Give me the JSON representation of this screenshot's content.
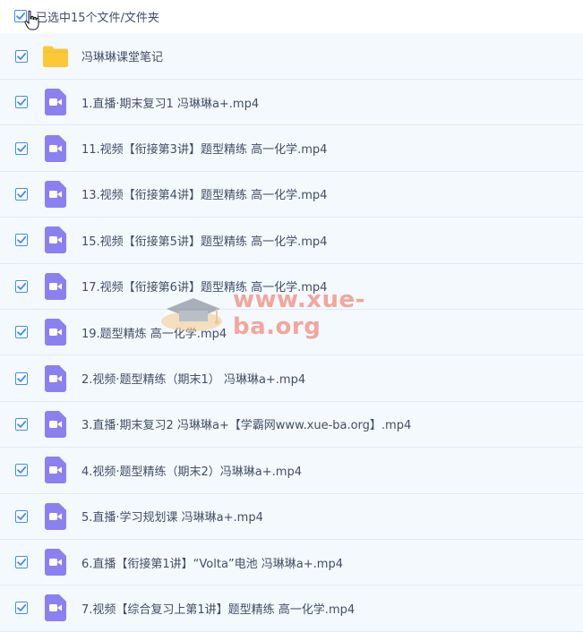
{
  "header": {
    "selection_label": "已选中15个文件/文件夹"
  },
  "colors": {
    "accent": "#3b8cff",
    "video_icon": "#8b80f0",
    "folder_icon": "#fcc838",
    "row_bg": "#f4f9fe"
  },
  "files": [
    {
      "name": "冯琳琳课堂笔记",
      "icon": "folder-icon"
    },
    {
      "name": "1.直播·期末复习1 冯琳琳a+.mp4",
      "icon": "video-file-icon"
    },
    {
      "name": "11.视频【衔接第3讲】题型精练 高一化学.mp4",
      "icon": "video-file-icon"
    },
    {
      "name": "13.视频【衔接第4讲】题型精练 高一化学.mp4",
      "icon": "video-file-icon"
    },
    {
      "name": "15.视频【衔接第5讲】题型精练 高一化学.mp4",
      "icon": "video-file-icon"
    },
    {
      "name": "17.视频【衔接第6讲】题型精练 高一化学.mp4",
      "icon": "video-file-icon"
    },
    {
      "name": "19.题型精炼 高一化学.mp4",
      "icon": "video-file-icon"
    },
    {
      "name": "2.视频·题型精练（期末1） 冯琳琳a+.mp4",
      "icon": "video-file-icon"
    },
    {
      "name": "3.直播·期末复习2 冯琳琳a+【学霸网www.xue-ba.org】.mp4",
      "icon": "video-file-icon"
    },
    {
      "name": "4.视频·题型精练（期末2）冯琳琳a+.mp4",
      "icon": "video-file-icon"
    },
    {
      "name": "5.直播·学习规划课 冯琳琳a+.mp4",
      "icon": "video-file-icon"
    },
    {
      "name": "6.直播【衔接第1讲】“Volta”电池 冯琳琳a+.mp4",
      "icon": "video-file-icon"
    },
    {
      "name": "7.视频【综合复习上第1讲】题型精练 高一化学.mp4",
      "icon": "video-file-icon"
    }
  ],
  "watermark": {
    "text": "www.xue-ba.org"
  }
}
